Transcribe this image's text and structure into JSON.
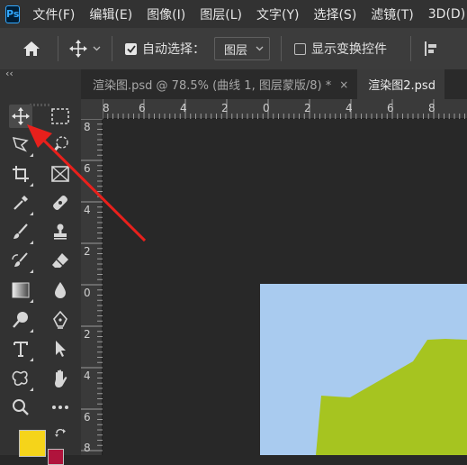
{
  "app": {
    "logo_text": "Ps"
  },
  "menu": [
    "文件(F)",
    "编辑(E)",
    "图像(I)",
    "图层(L)",
    "文字(Y)",
    "选择(S)",
    "滤镜(T)",
    "3D(D)"
  ],
  "options_bar": {
    "auto_select_label": "自动选择：",
    "auto_select_checked": true,
    "target_value": "图层",
    "transform_controls_label": "显示变换控件",
    "transform_controls_checked": false
  },
  "panel_collapse": "‹‹",
  "tabs": [
    {
      "label": "渲染图.psd @ 78.5% (曲线 1, 图层蒙版/8) *",
      "close": "×",
      "active": false
    },
    {
      "label": "渲染图2.psd",
      "active": true
    }
  ],
  "rulers": {
    "horizontal": [
      "8",
      "6",
      "4",
      "2",
      "0",
      "2",
      "4",
      "6",
      "8"
    ],
    "vertical": [
      "8",
      "6",
      "4",
      "2",
      "0",
      "2",
      "4",
      "6",
      "8"
    ]
  },
  "tools": [
    "move-tool",
    "marquee-tool",
    "lasso-tool",
    "quick-select-tool",
    "crop-tool",
    "frame-tool",
    "eyedropper-tool",
    "healing-brush-tool",
    "brush-tool",
    "clone-stamp-tool",
    "history-brush-tool",
    "eraser-tool",
    "gradient-tool",
    "blur-tool",
    "dodge-tool",
    "pen-tool",
    "type-tool",
    "path-selection-tool",
    "custom-shape-tool",
    "hand-tool",
    "zoom-tool",
    "more-tools"
  ],
  "colors": {
    "foreground": "#f5d41a",
    "background": "#b0133c",
    "canvas_sky": "#a9cbef",
    "canvas_hill": "#a6c420",
    "annotation_arrow": "#e8201c"
  }
}
